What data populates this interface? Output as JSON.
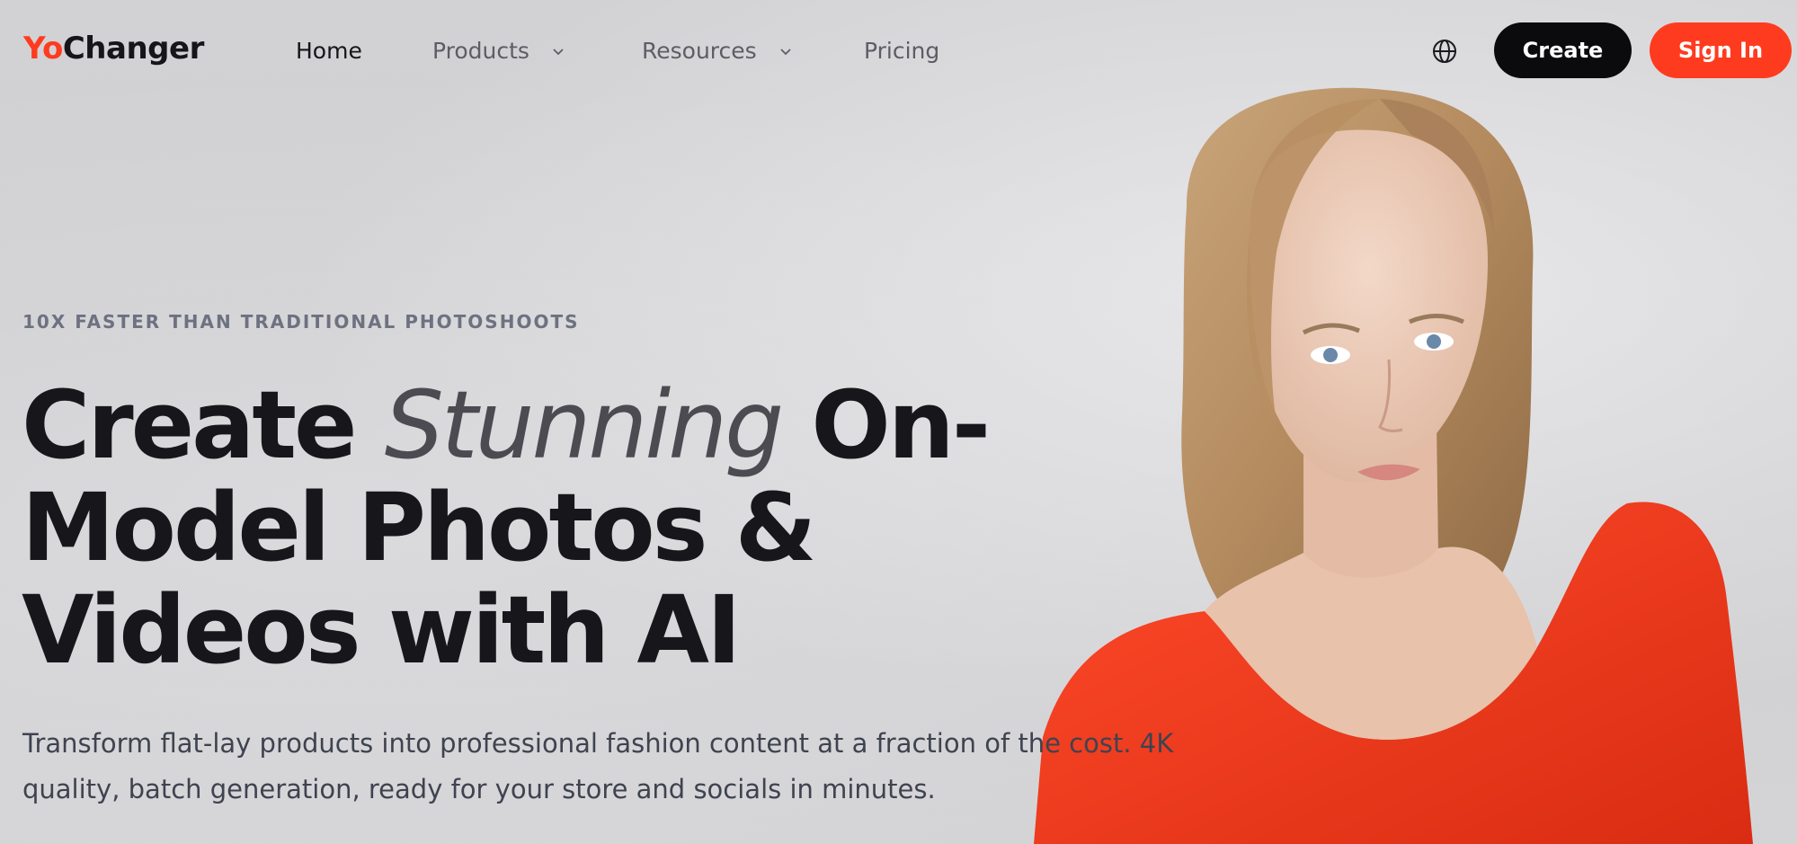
{
  "nav": {
    "logo_part1": "Yo",
    "logo_part2": "Changer",
    "links": [
      {
        "label": "Home",
        "active": true,
        "dropdown": false
      },
      {
        "label": "Products",
        "active": false,
        "dropdown": true
      },
      {
        "label": "Resources",
        "active": false,
        "dropdown": true
      },
      {
        "label": "Pricing",
        "active": false,
        "dropdown": false
      }
    ],
    "language_icon": "globe-icon",
    "create_label": "Create",
    "signin_label": "Sign In"
  },
  "hero": {
    "eyebrow": "10X FASTER THAN TRADITIONAL PHOTOSHOOTS",
    "headline_part1": "Create ",
    "headline_emphasis": "Stunning",
    "headline_part2": " On-Model Photos & Videos with AI",
    "subtext": "Transform flat-lay products into professional fashion content at a fraction of the cost. 4K quality, batch generation, ready for your store and socials in minutes."
  },
  "colors": {
    "brand_accent": "#ff3b1f",
    "dark": "#0b0b0d",
    "background": "#d0d0d2"
  }
}
